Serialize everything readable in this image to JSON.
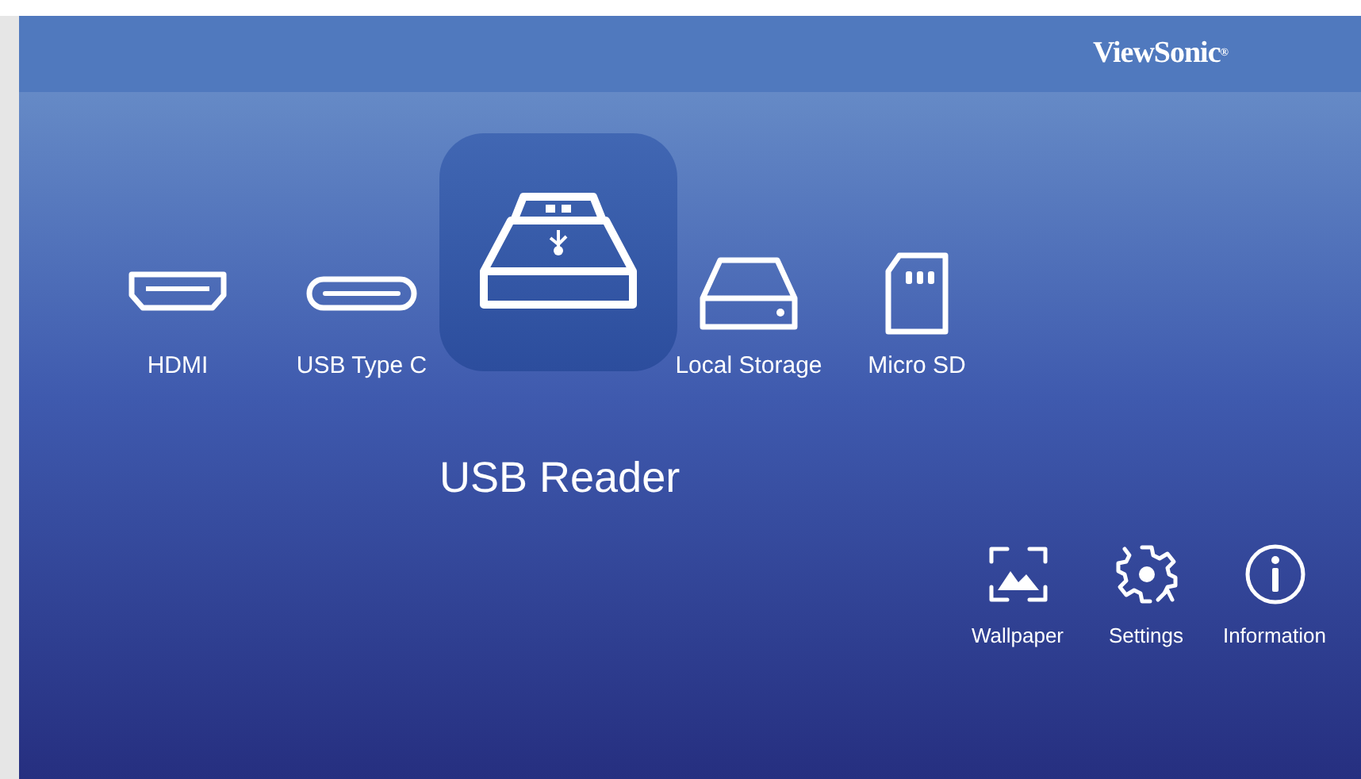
{
  "header": {
    "logo": "ViewSonic$^{®}$"
  },
  "sources": [
    {
      "kind": "hdmi",
      "label": "HDMI",
      "selected": false
    },
    {
      "kind": "usb_c",
      "label": "USB Type C",
      "selected": false
    },
    {
      "kind": "usb_reader",
      "label": "USB Reader",
      "selected": true
    },
    {
      "kind": "local_storage",
      "label": "Local Storage",
      "selected": false
    },
    {
      "kind": "micro_sd",
      "label": "Micro SD",
      "selected": false
    }
  ],
  "tools": [
    {
      "kind": "wallpaper",
      "label": "Wallpaper"
    },
    {
      "kind": "settings",
      "label": "Settings"
    },
    {
      "kind": "information",
      "label": "Information"
    }
  ]
}
